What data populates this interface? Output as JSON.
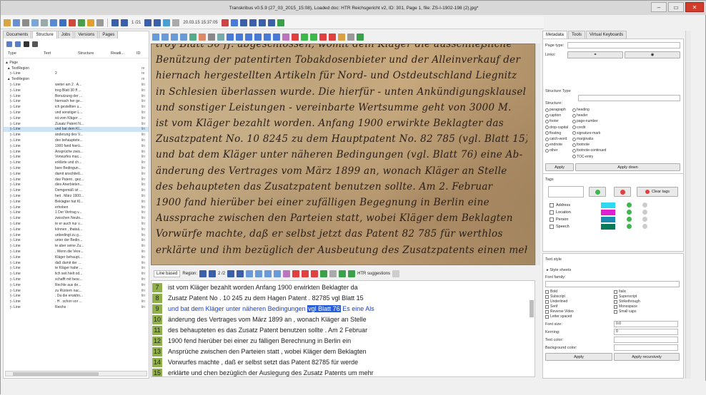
{
  "window": {
    "title": "Transkribus v0.5.9 (27_03_2015_15:08), Loaded doc: HTR Reichsgericht v2, ID: 301, Page 1, file: ZS-I-1902-198 (2).jpg*",
    "buttons": [
      "–",
      "▭",
      "✕"
    ]
  },
  "toolbar": {
    "page_counter": "1 /21",
    "date_field": "20.03.15 15:37:05",
    "icons": [
      "home-icon",
      "edit-icon",
      "document-icon",
      "user-icon",
      "upload-icon",
      "download-icon",
      "save-icon",
      "delete-icon",
      "add-icon",
      "export-icon",
      "settings-icon",
      "first-page-icon",
      "prev-page-icon",
      "next-page-icon",
      "last-page-icon",
      "refresh-icon",
      "grid-icon",
      "columns-icon",
      "rows-icon",
      "play-icon"
    ]
  },
  "left_panel": {
    "tabs": [
      "Documents",
      "Structure",
      "Jobs",
      "Versions",
      "Pages"
    ],
    "active_tab": "Structure",
    "columns": [
      "Type",
      "Text",
      "Structure",
      "Readi...",
      "ID"
    ],
    "rows": [
      {
        "type": "▲ Page",
        "text": "",
        "id": ""
      },
      {
        "type": "  ▲ TextRegion",
        "text": "",
        "id": "re"
      },
      {
        "type": "     ▷ Line",
        "text": "2",
        "id": "re"
      },
      {
        "type": "  ▲ TextRegion",
        "text": "",
        "id": "re"
      },
      {
        "type": "     ▷ Line",
        "text": "weiter am 2 . A...",
        "id": "lin"
      },
      {
        "type": "     ▷ Line",
        "text": "treg Blatt 30 ff ...",
        "id": "lin"
      },
      {
        "type": "     ▷ Line",
        "text": "Benutzung der ...",
        "id": "lin"
      },
      {
        "type": "     ▷ Line",
        "text": "hiernach her ge...",
        "id": "lin"
      },
      {
        "type": "     ▷ Line",
        "text": "ich gestellten u...",
        "id": "lin"
      },
      {
        "type": "     ▷ Line",
        "text": "und sonstiger L...",
        "id": "lin"
      },
      {
        "type": "     ▷ Line",
        "text": "ist vom Kläger ...",
        "id": "lin"
      },
      {
        "type": "     ▷ Line",
        "text": "Zusatz Patent N...",
        "id": "lin"
      },
      {
        "type": "     ▷ Line",
        "text": "und bat dem Kl...",
        "id": "lin"
      },
      {
        "type": "     ▷ Line",
        "text": "änderung des V...",
        "id": "lin"
      },
      {
        "type": "     ▷ Line",
        "text": "des behauptete...",
        "id": "lin"
      },
      {
        "type": "     ▷ Line",
        "text": "1900 fand hierü...",
        "id": "lin"
      },
      {
        "type": "     ▷ Line",
        "text": "Ansprüche zwis...",
        "id": "lin"
      },
      {
        "type": "     ▷ Line",
        "text": "Vorwurfes mac...",
        "id": "lin"
      },
      {
        "type": "     ▷ Line",
        "text": "erklärte und ch...",
        "id": "lin"
      },
      {
        "type": "     ▷ Line",
        "text": "bare Bedingun...",
        "id": "lin"
      },
      {
        "type": "     ▷ Line",
        "text": "damit anschließ...",
        "id": "lin"
      },
      {
        "type": "     ▷ Line",
        "text": "das Patent , gez...",
        "id": "lin"
      },
      {
        "type": "     ▷ Line",
        "text": "dies Anerbieten...",
        "id": "lin"
      },
      {
        "type": "     ▷ Line",
        "text": "Demgemäß ist ...",
        "id": "lin"
      },
      {
        "type": "     ▷ Line",
        "text": "heit . März 1900...",
        "id": "lin"
      },
      {
        "type": "     ▷ Line",
        "text": "Beklagter hat Kl...",
        "id": "lin"
      },
      {
        "type": "     ▷ Line",
        "text": "erhoben",
        "id": "lin"
      },
      {
        "type": "     ▷ Line",
        "text": "1 Der Vertrag v...",
        "id": "lin"
      },
      {
        "type": "     ▷ Line",
        "text": "zwischen Neulo...",
        "id": "lin"
      },
      {
        "type": "     ▷ Line",
        "text": "te er auch nur v...",
        "id": "lin"
      },
      {
        "type": "     ▷ Line",
        "text": "können , thatsä...",
        "id": "lin"
      },
      {
        "type": "     ▷ Line",
        "text": "unbedingt zu g...",
        "id": "lin"
      },
      {
        "type": "     ▷ Line",
        "text": "unter der Bedin...",
        "id": "lin"
      },
      {
        "type": "     ▷ Line",
        "text": "te aber seine Zu...",
        "id": "lin"
      },
      {
        "type": "     ▷ Line",
        "text": ". Wenn die Vere...",
        "id": "lin"
      },
      {
        "type": "     ▷ Line",
        "text": "Kläger behaupt...",
        "id": "lin"
      },
      {
        "type": "     ▷ Line",
        "text": "daß damit der ...",
        "id": "lin"
      },
      {
        "type": "     ▷ Line",
        "text": "te Kläger habe ...",
        "id": "lin"
      },
      {
        "type": "     ▷ Line",
        "text": "lich seit hielt od...",
        "id": "lin"
      },
      {
        "type": "     ▷ Line",
        "text": "schafft mit besc...",
        "id": "lin"
      },
      {
        "type": "     ▷ Line",
        "text": "Rechte aus de...",
        "id": "lin"
      },
      {
        "type": "     ▷ Line",
        "text": "zu Rüstern nac...",
        "id": "lin"
      },
      {
        "type": "     ▷ Line",
        "text": ". Da die erwähn...",
        "id": "lin"
      },
      {
        "type": "     ▷ Line",
        "text": ". H . schon vor ...",
        "id": "lin"
      },
      {
        "type": "     ▷ Line",
        "text": "Reichs",
        "id": "lin"
      }
    ],
    "selected_index": 12
  },
  "image": {
    "handwriting_lines": [
      "troy Blatt 30 ff. abgeschlossen, womit dein Kläger die ausschließliche",
      "Benützung der patentirten Tobakdosenbieter und der Alleinverkauf der",
      "hiernach hergestellten Artikeln für Nord- und Ostdeutschland Liegnitz",
      "in Schlesien überlassen wurde. Die hierfür - unten Ankündigungsklausel",
      "und sonstiger Leistungen - vereinbarte Wertsumme geht von 3000 M.",
      "ist vom Kläger bezahlt worden. Anfang 1900 erwirkte Beklagter das",
      "Zusatzpatent No. 10 8245 zu dem Hauptpatent No. 82 785 (vgl. Blatt 15)",
      "und bat dem Kläger unter näheren Bedingungen (vgl. Blatt 76) eine Ab-",
      "änderung des Vertrages vom März 1899 an, wonach Kläger an Stelle",
      "des behaupteten das Zusatzpatent benutzen sollte. Am 2. Februar",
      "1900 fand hierüber bei einer zufälligen Begegnung in Berlin eine",
      "Aussprache zwischen den Parteien statt, wobei Kläger dem Beklagten",
      "Vorwürfe machte, daß er selbst jetzt das Patent 82 785 für werthlos",
      "erklärte und ihm bezüglich der Ausbeutung des Zusatzpatents einen mehr-"
    ]
  },
  "line_editor": {
    "toolbar": {
      "mode": "Line based",
      "region_label": "Region:",
      "region_counter": "2 /2",
      "htr_label": "HTR suggestions"
    },
    "lines": [
      {
        "num": "7",
        "text": "ist vom Kläger bezahlt worden Anfang 1900 erwirkten Beklagter da"
      },
      {
        "num": "8",
        "text": "Zusatz Patent No . 10 245 zu dem Hagen Patent . 82785 vgl Blatt 15"
      },
      {
        "num": "9",
        "text_before": "und bat dem Kläger unter näheren Bedingungen ",
        "text_highlight": "vgl Blatt 76",
        "text_after": " Es eine Als"
      },
      {
        "num": "10",
        "text": "änderung des Vertrages vom März 1899 an , wonach Kläger an Stelle"
      },
      {
        "num": "11",
        "text": "des behaupteten es das Zusatz Patent benutzen sollte . Am 2 Februar"
      },
      {
        "num": "12",
        "text": "1900 fend hierüber bei einer zu fälligen Berechnung in Berlin ein"
      },
      {
        "num": "13",
        "text": "Ansprüche zwischen den Parteien statt , wobei Kläger dem Beklagten"
      },
      {
        "num": "14",
        "text": "Vorwurfes machte , daß er selbst setzt das Patent 82785 für werde"
      },
      {
        "num": "15",
        "text": "erklärte und chen bezüglich der Auslegung des Zusatz Patents um mehr"
      }
    ]
  },
  "right_panel": {
    "tabs": [
      "Metadata",
      "Tools",
      "Virtual Keyboards"
    ],
    "page_type_label": "Page type:",
    "links_label": "Links:",
    "structure_type_label": "Structure Type",
    "structure_label": "Structure:",
    "structure_options_left": [
      "paragraph",
      "caption",
      "footer",
      "drop-capital",
      "floating",
      "catch-word",
      "endnote",
      "other"
    ],
    "structure_options_right": [
      "heading",
      "header",
      "page-number",
      "credit",
      "signature-mark",
      "marginalia",
      "footnote",
      "footnote-continued",
      "TOC-entry"
    ],
    "apply_label": "Apply",
    "apply_down_label": "Apply down",
    "tags_label": "Tags",
    "clear_tags_label": "Clear tags",
    "tags": [
      {
        "name": "Address",
        "color": "#30d8f0"
      },
      {
        "name": "Location",
        "color": "#e020d0"
      },
      {
        "name": "Person",
        "color": "#1a8cb0"
      },
      {
        "name": "Speech",
        "color": "#0a7a5a"
      }
    ],
    "text_style_label": "Text style",
    "style_sheets_label": "▸ Style sheets",
    "font_family_label": "Font family:",
    "style_checks_left": [
      "Bold",
      "Subscript",
      "Underlined",
      "Serif",
      "Reverse Video",
      "Letter spaced"
    ],
    "style_checks_right": [
      "Italic",
      "Superscript",
      "Strikethrough",
      "Monospace",
      "Small caps"
    ],
    "font_size_label": "Font size:",
    "font_size_value": "0.0",
    "kerning_label": "Kerning:",
    "kerning_value": "0",
    "text_color_label": "Text color:",
    "bg_color_label": "Background color:",
    "apply_recursively_label": "Apply recursively"
  }
}
